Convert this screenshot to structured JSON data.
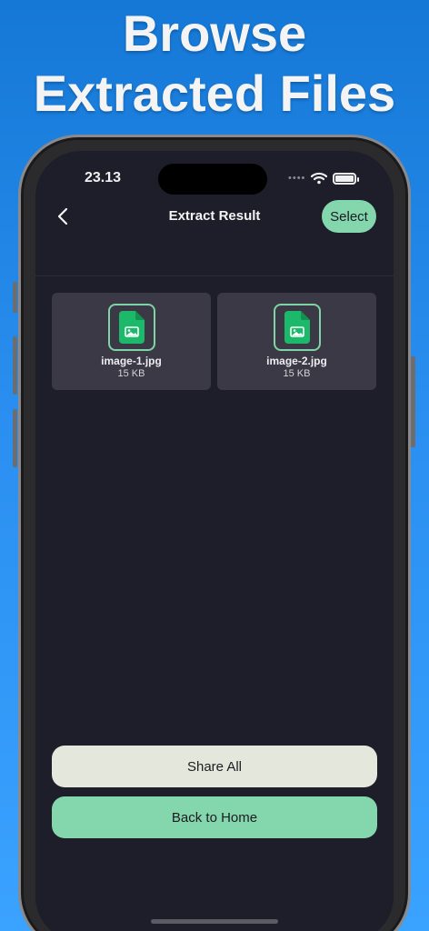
{
  "headline": {
    "line1": "Browse",
    "line2": "Extracted Files"
  },
  "status_bar": {
    "time": "23.13",
    "signal": "••••"
  },
  "nav": {
    "title": "Extract Result",
    "select_label": "Select"
  },
  "files": [
    {
      "name": "image-1.jpg",
      "size": "15 KB"
    },
    {
      "name": "image-2.jpg",
      "size": "15 KB"
    }
  ],
  "actions": {
    "share_all_label": "Share All",
    "back_home_label": "Back to Home"
  },
  "icons": {
    "back": "chevron-left-icon",
    "file": "image-file-icon",
    "wifi": "wifi-icon",
    "battery": "battery-icon"
  },
  "colors": {
    "accent": "#84d6ac",
    "file_icon": "#1db96a",
    "screen_bg": "#1e1e2b",
    "tile_bg": "#3a3945",
    "share_button": "#e4e7dc"
  }
}
